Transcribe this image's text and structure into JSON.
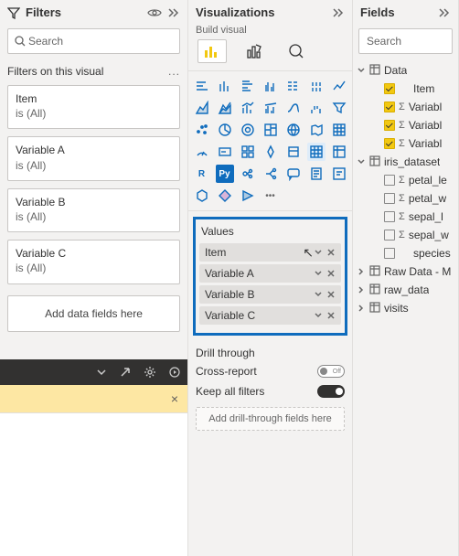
{
  "filters": {
    "title": "Filters",
    "search_placeholder": "Search",
    "section_label": "Filters on this visual",
    "dots": "...",
    "cards": [
      {
        "name": "Item",
        "value": "is (All)"
      },
      {
        "name": "Variable A",
        "value": "is (All)"
      },
      {
        "name": "Variable B",
        "value": "is (All)"
      },
      {
        "name": "Variable C",
        "value": "is (All)"
      }
    ],
    "add_prompt": "Add data fields here",
    "dismiss": "×"
  },
  "viz": {
    "title": "Visualizations",
    "build_label": "Build visual",
    "values_label": "Values",
    "value_fields": [
      {
        "name": "Item",
        "cursor": true
      },
      {
        "name": "Variable A"
      },
      {
        "name": "Variable B"
      },
      {
        "name": "Variable C"
      }
    ],
    "drill_label": "Drill through",
    "cross_report_label": "Cross-report",
    "cross_report_state": "Off",
    "keep_filters_label": "Keep all filters",
    "keep_filters_state": "On",
    "add_drill_prompt": "Add drill-through fields here",
    "gallery": [
      "stacked-bar",
      "stacked-column",
      "clustered-bar",
      "clustered-column",
      "100-bar",
      "100-column",
      "line",
      "area",
      "stacked-area",
      "line-stacked",
      "line-clustered",
      "ribbon",
      "waterfall",
      "funnel",
      "scatter",
      "pie",
      "donut",
      "treemap",
      "map",
      "filled-map",
      "azure-map",
      "gauge",
      "card",
      "multi-card",
      "kpi",
      "slicer",
      "table",
      "matrix",
      "r-visual",
      "py-visual",
      "key-influencers",
      "decomposition",
      "qna",
      "paginated",
      "narrative",
      "arcgis",
      "power-apps",
      "power-automate",
      "more",
      "",
      "",
      ""
    ]
  },
  "fields": {
    "title": "Fields",
    "search_placeholder": "Search",
    "tables": [
      {
        "name": "Data",
        "expanded": true,
        "cols": [
          {
            "name": "Item",
            "checked": true,
            "sigma": false
          },
          {
            "name": "Variable A",
            "checked": true,
            "sigma": true,
            "trunc": "Variabl"
          },
          {
            "name": "Variable B",
            "checked": true,
            "sigma": true,
            "trunc": "Variabl"
          },
          {
            "name": "Variable C",
            "checked": true,
            "sigma": true,
            "trunc": "Variabl"
          }
        ]
      },
      {
        "name": "iris_dataset",
        "expanded": true,
        "cols": [
          {
            "name": "petal_length",
            "checked": false,
            "sigma": true,
            "trunc": "petal_le"
          },
          {
            "name": "petal_width",
            "checked": false,
            "sigma": true,
            "trunc": "petal_w"
          },
          {
            "name": "sepal_length",
            "checked": false,
            "sigma": true,
            "trunc": "sepal_l"
          },
          {
            "name": "sepal_width",
            "checked": false,
            "sigma": true,
            "trunc": "sepal_w"
          },
          {
            "name": "species",
            "checked": false,
            "sigma": false,
            "trunc": "species"
          }
        ]
      },
      {
        "name": "Raw Data - M",
        "expanded": false
      },
      {
        "name": "raw_data",
        "expanded": false
      },
      {
        "name": "visits",
        "expanded": false
      }
    ]
  }
}
